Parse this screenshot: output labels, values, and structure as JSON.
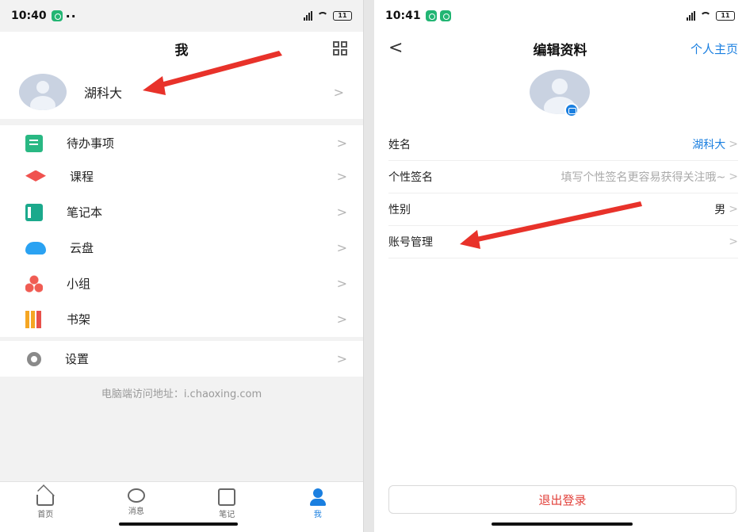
{
  "left_screen": {
    "status": {
      "time": "10:40",
      "extra": "··",
      "battery": "11"
    },
    "title": "我",
    "qr_icon": "qr-code-icon",
    "profile": {
      "name": "湖科大"
    },
    "group1": [
      {
        "label": "待办事项",
        "icon": "todo-icon"
      }
    ],
    "group2": [
      {
        "label": "课程",
        "icon": "graduation-cap-icon"
      },
      {
        "label": "笔记本",
        "icon": "notebook-icon"
      },
      {
        "label": "云盘",
        "icon": "cloud-icon"
      },
      {
        "label": "小组",
        "icon": "group-icon"
      },
      {
        "label": "书架",
        "icon": "bookshelf-icon"
      }
    ],
    "group3": [
      {
        "label": "设置",
        "icon": "gear-icon"
      }
    ],
    "url_text": "电脑端访问地址：i.chaoxing.com",
    "tabs": [
      {
        "label": "首页",
        "icon": "home-icon"
      },
      {
        "label": "消息",
        "icon": "message-icon"
      },
      {
        "label": "笔记",
        "icon": "note-edit-icon"
      },
      {
        "label": "我",
        "icon": "person-icon",
        "active": true
      }
    ]
  },
  "right_screen": {
    "status": {
      "time": "10:41",
      "battery": "11"
    },
    "back": "<",
    "title": "编辑资料",
    "nav_link": "个人主页",
    "rows": [
      {
        "key": "姓名",
        "value": "湖科大",
        "style": "blue"
      },
      {
        "key": "个性签名",
        "value": "填写个性签名更容易获得关注哦~",
        "style": "grey"
      },
      {
        "key": "性别",
        "value": "男",
        "style": "normal"
      },
      {
        "key": "账号管理",
        "value": "",
        "style": "normal"
      }
    ],
    "logout_label": "退出登录"
  },
  "colors": {
    "accent": "#1a7fe0",
    "danger": "#e2413b",
    "annotation_arrow": "#e8322a"
  }
}
